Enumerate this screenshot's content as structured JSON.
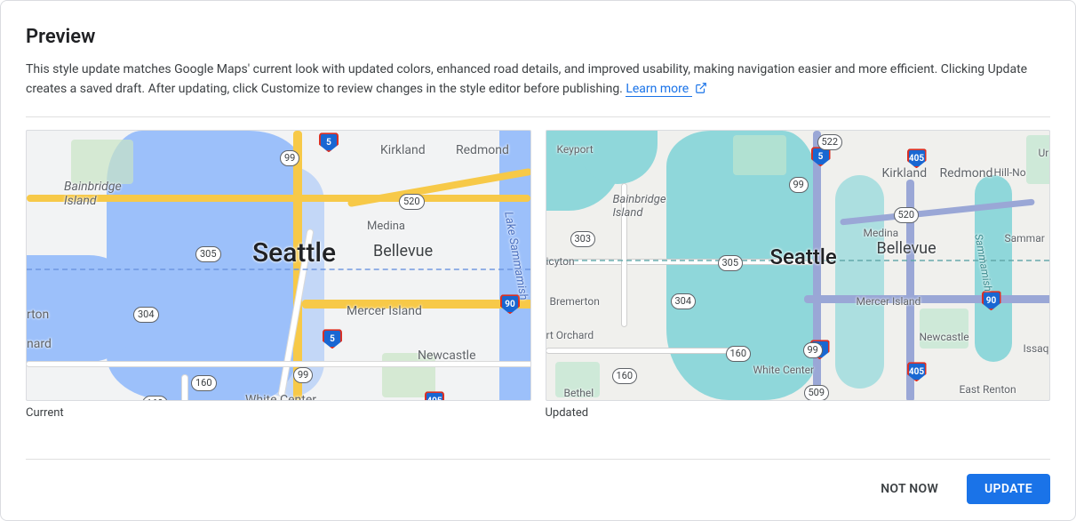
{
  "title": "Preview",
  "description_main": "This style update matches Google Maps' current look with updated colors, enhanced road details, and improved usability, making navigation easier and more efficient. Clicking Update creates a saved draft. After updating, click Customize to review changes in the style editor before publishing. ",
  "learn_more": "Learn more",
  "maps": {
    "left_caption": "Current",
    "right_caption": "Updated",
    "big_city": "Seattle",
    "cities_med": {
      "bellevue": "Bellevue",
      "kirkland": "Kirkland",
      "redmond": "Redmond",
      "medina": "Medina",
      "mercer": "Mercer Island",
      "newcastle": "Newcastle",
      "bainbridge": "Bainbridge\nIsland",
      "whitecenter": "White Center",
      "keyport": "Keyport",
      "bremerton": "Bremerton",
      "portorchard": "rt Orchard",
      "bethel": "Bethel",
      "eastrenton": "East Renton",
      "hillno": "Hill-No",
      "issaq": "Issaq",
      "ur": "Ur",
      "rton": "rton",
      "nard": "nard",
      "icyton": "icyton"
    },
    "water_label_left": "Lake Sammamish",
    "water_label_right": "Sammamish",
    "sammar": "Sammar",
    "badges": {
      "r99": "99",
      "r520": "520",
      "r305": "305",
      "r304": "304",
      "r303": "303",
      "r160": "160",
      "r522": "522",
      "r509": "509",
      "r90": "90",
      "r5": "5",
      "r405": "405"
    }
  },
  "buttons": {
    "not_now": "NOT NOW",
    "update": "UPDATE"
  }
}
